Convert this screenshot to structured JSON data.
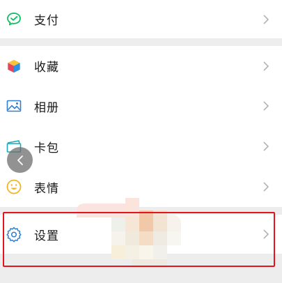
{
  "menu": {
    "items": [
      {
        "label": "支付",
        "icon": "wechat-pay-icon"
      },
      {
        "label": "收藏",
        "icon": "favorites-cube-icon"
      },
      {
        "label": "相册",
        "icon": "album-picture-icon"
      },
      {
        "label": "卡包",
        "icon": "card-wallet-icon"
      },
      {
        "label": "表情",
        "icon": "emoji-smile-icon"
      },
      {
        "label": "设置",
        "icon": "gear-icon"
      }
    ]
  },
  "colors": {
    "pay_green": "#07c160",
    "album_blue": "#2f7fd4",
    "card_teal": "#1aa9b5",
    "emoji_yellow": "#f2b21c",
    "settings_blue": "#2d7fd0",
    "highlight_red": "#e3141c",
    "background": "#ededed"
  }
}
